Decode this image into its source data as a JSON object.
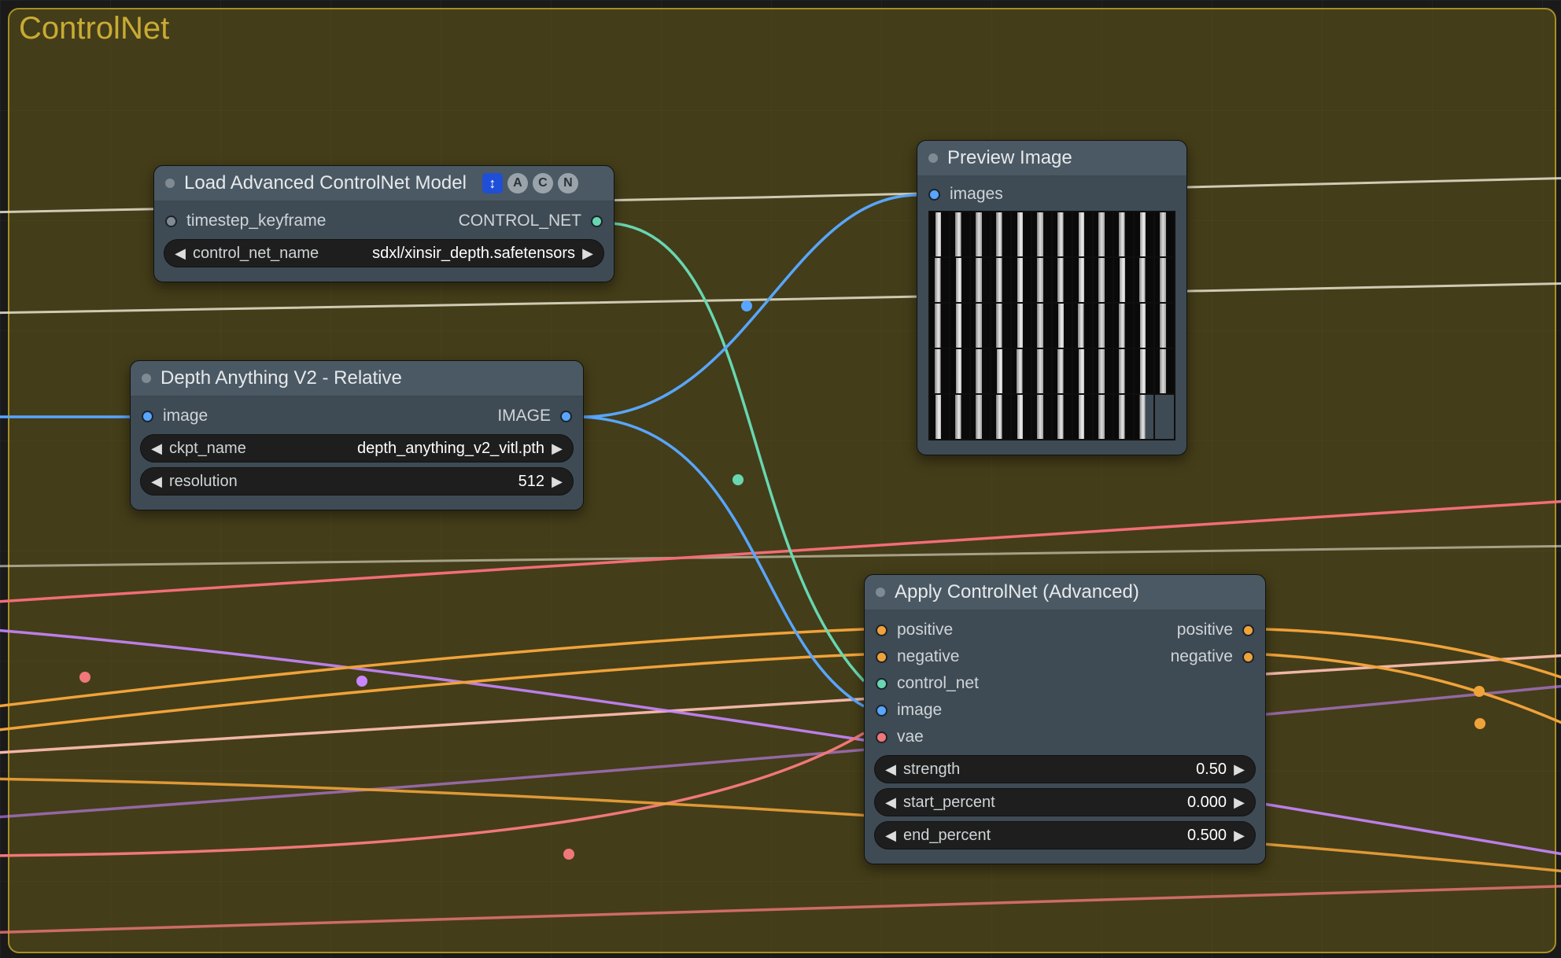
{
  "group": {
    "title": "ControlNet"
  },
  "colors": {
    "mint": "#68d7b1",
    "blue": "#58a6ff",
    "orange": "#f0a33a",
    "red": "#f07878",
    "pink": "#f29bc0",
    "purple": "#c886ff",
    "cream": "#e8e3cf"
  },
  "nodes": {
    "load": {
      "title": "Load Advanced ControlNet Model",
      "badges": [
        "↕",
        "A",
        "C",
        "N"
      ],
      "inputs": [
        {
          "name": "timestep_keyframe",
          "color": "gray"
        }
      ],
      "outputs": [
        {
          "name": "CONTROL_NET",
          "color": "mint"
        }
      ],
      "widgets": [
        {
          "name": "control_net_name",
          "value": "sdxl/xinsir_depth.safetensors"
        }
      ]
    },
    "depth": {
      "title": "Depth Anything V2 - Relative",
      "inputs": [
        {
          "name": "image",
          "color": "blue"
        }
      ],
      "outputs": [
        {
          "name": "IMAGE",
          "color": "blue"
        }
      ],
      "widgets": [
        {
          "name": "ckpt_name",
          "value": "depth_anything_v2_vitl.pth"
        },
        {
          "name": "resolution",
          "value": "512"
        }
      ]
    },
    "preview": {
      "title": "Preview Image",
      "inputs": [
        {
          "name": "images",
          "color": "blue"
        }
      ],
      "grid": {
        "rows": 5,
        "cols": 12,
        "last_row_filled": 11
      }
    },
    "apply": {
      "title": "Apply ControlNet (Advanced)",
      "inputs": [
        {
          "name": "positive",
          "color": "orange"
        },
        {
          "name": "negative",
          "color": "orange"
        },
        {
          "name": "control_net",
          "color": "mint"
        },
        {
          "name": "image",
          "color": "blue"
        },
        {
          "name": "vae",
          "color": "red"
        }
      ],
      "outputs": [
        {
          "name": "positive",
          "color": "orange"
        },
        {
          "name": "negative",
          "color": "orange"
        }
      ],
      "widgets": [
        {
          "name": "strength",
          "value": "0.50"
        },
        {
          "name": "start_percent",
          "value": "0.000"
        },
        {
          "name": "end_percent",
          "value": "0.500"
        }
      ]
    }
  }
}
